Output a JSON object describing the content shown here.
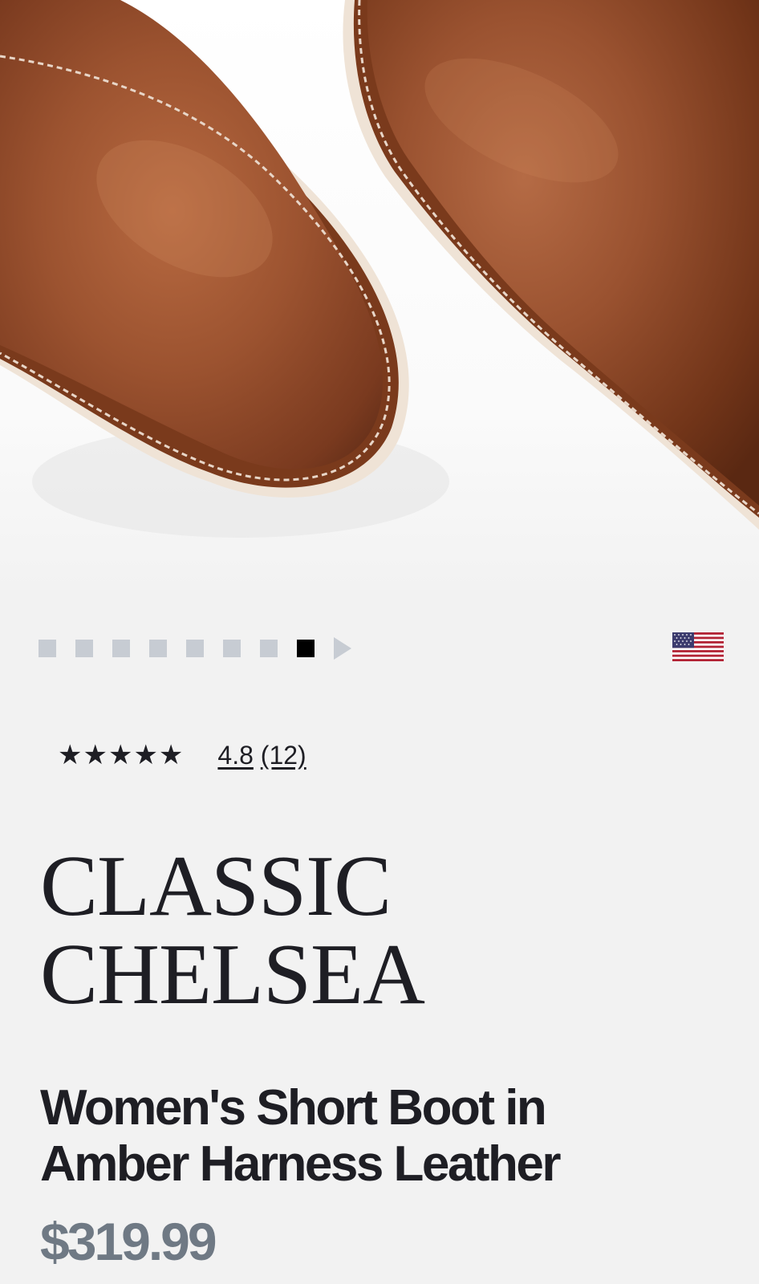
{
  "gallery": {
    "image_alt": "Classic Chelsea boots in Amber Harness Leather, top view",
    "dots_count": 8,
    "active_index": 7,
    "next_icon": "chevron-right-icon"
  },
  "locale": {
    "flag_icon": "us-flag-icon"
  },
  "rating": {
    "stars": "★★★★★",
    "value": "4.8",
    "count": "(12)"
  },
  "product": {
    "title_line1": "CLASSIC",
    "title_line2": "CHELSEA",
    "subtitle_line1": "Women's Short Boot in",
    "subtitle_line2": "Amber Harness Leather",
    "price": "$319.99"
  },
  "colors": {
    "background": "#f2f2f2",
    "text": "#1e1e24",
    "price": "#6f7984",
    "dot_inactive": "#c7ccd3",
    "dot_active": "#000000",
    "leather": "#8a4524"
  }
}
